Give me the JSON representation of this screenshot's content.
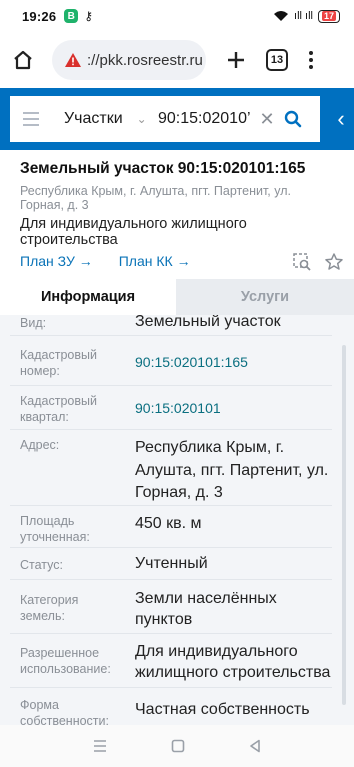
{
  "status_bar": {
    "time": "19:26",
    "notif_letter": "B",
    "notif_key": "⚷",
    "signal_text": "ıll ıll",
    "battery": "17"
  },
  "browser": {
    "url": "://pkk.rosreestr.ru",
    "tab_count": "13"
  },
  "search": {
    "category": "Участки",
    "query": "90:15:02010’"
  },
  "parcel": {
    "title": "Земельный участок 90:15:020101:165",
    "address": "Республика Крым, г. Алушта, пгт. Партенит, ул. Горная, д. 3",
    "purpose": "Для индивидуального жилищного строительства",
    "plan_zu": "План ЗУ →",
    "plan_kk": "План КК →"
  },
  "tabs": {
    "info": "Информация",
    "services": "Услуги"
  },
  "info_rows": [
    {
      "label": "Вид:",
      "value": "Земельный участок"
    },
    {
      "label": "Кадастровый номер:",
      "value": "90:15:020101:165"
    },
    {
      "label": "Кадастровый квартал:",
      "value": "90:15:020101"
    },
    {
      "label": "Адрес:",
      "value": "Республика Крым, г. Алушта, пгт. Партенит, ул. Горная, д. 3"
    },
    {
      "label": "Площадь уточненная:",
      "value": "450 кв. м"
    },
    {
      "label": "Статус:",
      "value": "Учтенный"
    },
    {
      "label": "Категория земель:",
      "value": "Земли населённых пунктов"
    },
    {
      "label": "Разрешенное использование:",
      "value": "Для индивидуального жилищного строительства"
    },
    {
      "label": "Форма собственности:",
      "value": "Частная собственность"
    }
  ],
  "colors": {
    "brand_blue": "#0070c0",
    "link": "#0a73b7",
    "warning_red": "#d9302c"
  }
}
